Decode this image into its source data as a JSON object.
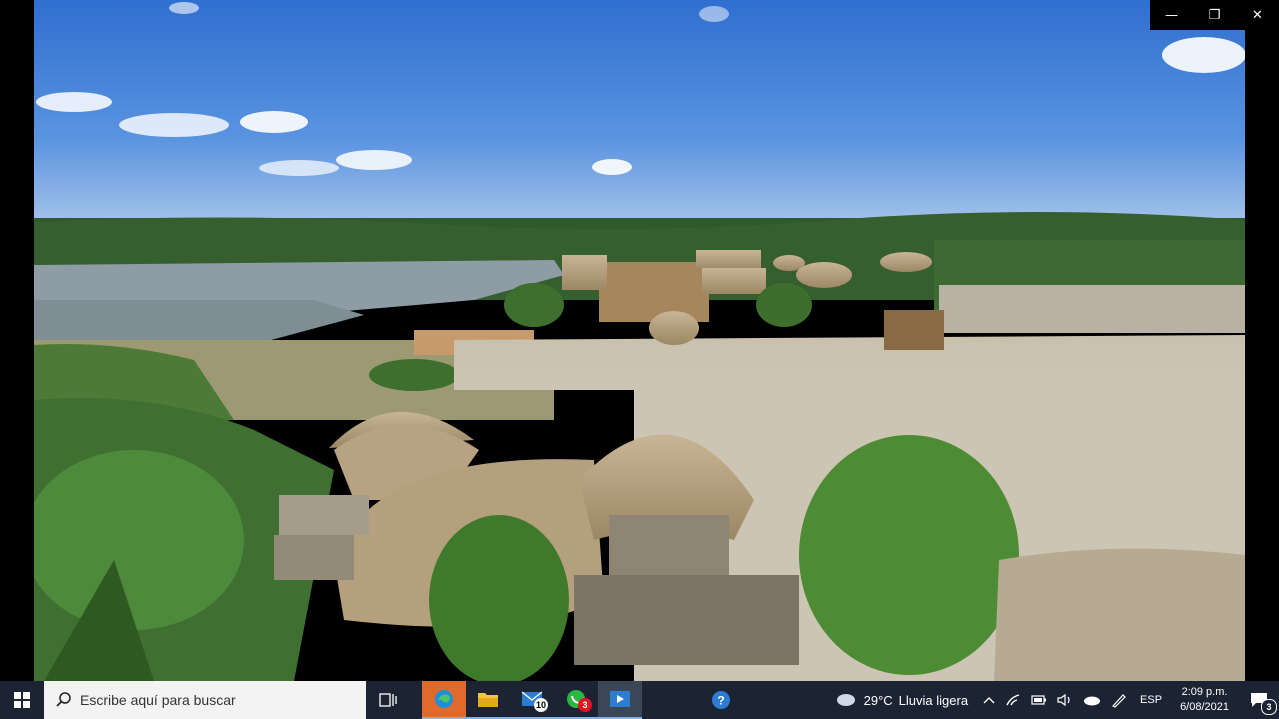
{
  "window": {
    "controls": {
      "minimize": "—",
      "restore": "❐",
      "close": "✕"
    }
  },
  "photo": {
    "description_icon": "photo-viewer-image"
  },
  "taskbar": {
    "search_placeholder": "Escribe aquí para buscar",
    "apps": [
      {
        "name": "task-view",
        "badge": ""
      },
      {
        "name": "edge",
        "badge": ""
      },
      {
        "name": "file-explorer",
        "badge": ""
      },
      {
        "name": "mail",
        "badge": "10"
      },
      {
        "name": "whatsapp",
        "badge": "3"
      },
      {
        "name": "photos",
        "badge": ""
      },
      {
        "name": "help",
        "badge": ""
      }
    ],
    "weather": {
      "temp": "29°C",
      "condition": "Lluvia ligera"
    },
    "language": "ESP",
    "clock": {
      "time": "2:09 p.m.",
      "date": "6/08/2021"
    },
    "notifications": "3"
  },
  "colors": {
    "taskbar": "#1c2433",
    "accent": "#0078d7",
    "badge_mail": "#ffffff",
    "badge_whatsapp": "#e81123"
  }
}
